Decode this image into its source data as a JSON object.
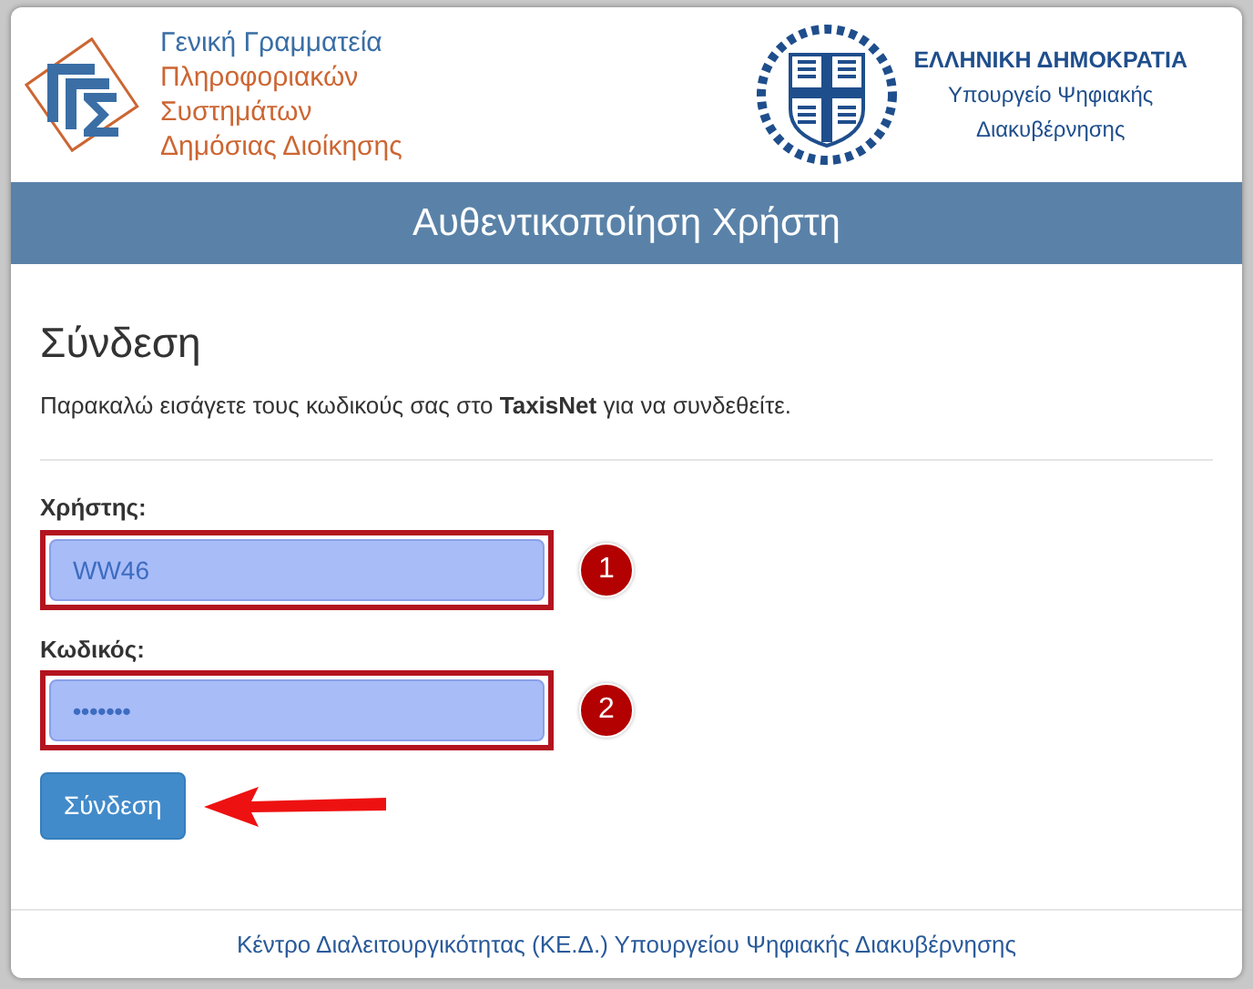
{
  "header": {
    "org_logo_lines": [
      "Γενική Γραμματεία",
      "Πληροφοριακών",
      "Συστημάτων",
      "Δημόσιας Διοίκησης"
    ],
    "state_title": "ΕΛΛΗΝΙΚΗ ΔΗΜΟΚΡΑΤΙΑ",
    "ministry_lines": [
      "Υπουργείο Ψηφιακής",
      "Διακυβέρνησης"
    ]
  },
  "banner": {
    "title": "Αυθεντικοποίηση Χρήστη"
  },
  "login": {
    "heading": "Σύνδεση",
    "intro": "Παρακαλώ εισάγετε τους κωδικούς σας στο **TaxisNet** για να συνδεθείτε.",
    "fields": [
      {
        "label": "Χρήστης:",
        "kind": "text",
        "value": "WW46",
        "marker": "1"
      },
      {
        "label": "Κωδικός:",
        "kind": "password",
        "value": "•••••••",
        "marker": "2"
      }
    ],
    "submit": "Σύνδεση"
  },
  "footer": {
    "link": "Κέντρο Διαλειτουργικότητας (ΚΕ.Δ.) Υπουργείου Ψηφιακής Διακυβέρνησης"
  }
}
